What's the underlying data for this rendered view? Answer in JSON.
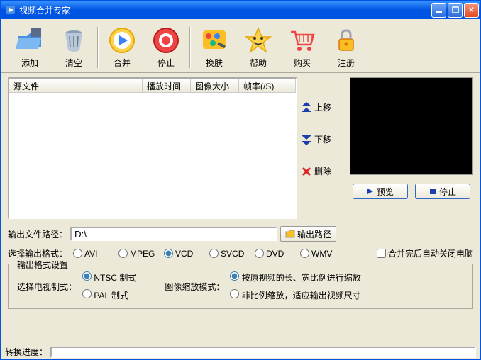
{
  "window": {
    "title": "视频合并专家"
  },
  "toolbar": {
    "add": "添加",
    "clear": "清空",
    "merge": "合并",
    "stop": "停止",
    "skin": "换肤",
    "help": "帮助",
    "buy": "购买",
    "register": "注册"
  },
  "table": {
    "col_source": "源文件",
    "col_duration": "播放时间",
    "col_size": "图像大小",
    "col_fps": "帧率(/S)"
  },
  "side": {
    "move_up": "上移",
    "move_down": "下移",
    "delete": "删除"
  },
  "preview": {
    "preview_btn": "预览",
    "stop_btn": "停止"
  },
  "output_path": {
    "label": "输出文件路径：",
    "value": "D:\\",
    "browse": "输出路径"
  },
  "output_format": {
    "label": "选择输出格式：",
    "options": {
      "avi": "AVI",
      "mpeg": "MPEG",
      "vcd": "VCD",
      "svcd": "SVCD",
      "dvd": "DVD",
      "wmv": "WMV"
    },
    "selected": "vcd"
  },
  "shutdown": {
    "label": "合并完后自动关闭电脑",
    "checked": false
  },
  "format_settings": {
    "legend": "输出格式设置",
    "tv_label": "选择电视制式：",
    "tv_ntsc": "NTSC 制式",
    "tv_pal": "PAL  制式",
    "tv_selected": "ntsc",
    "scale_label": "图像缩放模式：",
    "scale_prop": "按原视频的长、宽比例进行缩放",
    "scale_noprop": "非比例缩放，适应输出视频尺寸",
    "scale_selected": "prop"
  },
  "progress": {
    "label": "转换进度："
  }
}
